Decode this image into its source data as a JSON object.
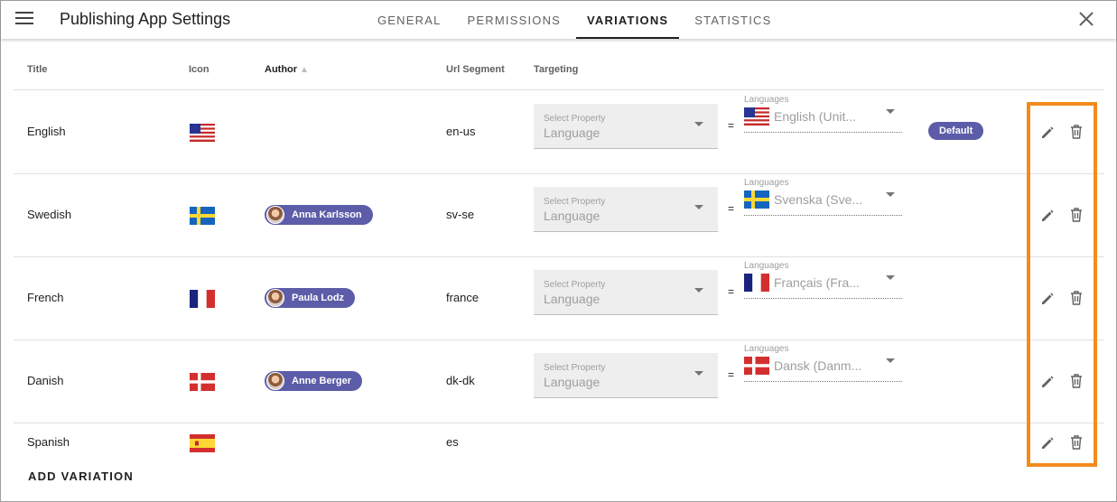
{
  "header": {
    "title": "Publishing App Settings",
    "tabs": [
      {
        "label": "GENERAL",
        "active": false
      },
      {
        "label": "PERMISSIONS",
        "active": false
      },
      {
        "label": "VARIATIONS",
        "active": true
      },
      {
        "label": "STATISTICS",
        "active": false
      }
    ]
  },
  "table": {
    "columns": {
      "title": "Title",
      "icon": "Icon",
      "author": "Author",
      "url_segment": "Url Segment",
      "targeting": "Targeting"
    },
    "rows": [
      {
        "title": "English",
        "flag": "us-flag",
        "author": null,
        "url_segment": "en-us",
        "select_label": "Select Property",
        "select_value": "Language",
        "equals": "=",
        "languages_label": "Languages",
        "language_value": "English (Unit...",
        "badge": "Default"
      },
      {
        "title": "Swedish",
        "flag": "se-flag",
        "author": "Anna Karlsson",
        "url_segment": "sv-se",
        "select_label": "Select Property",
        "select_value": "Language",
        "equals": "=",
        "languages_label": "Languages",
        "language_value": "Svenska (Sve..."
      },
      {
        "title": "French",
        "flag": "fr-flag",
        "author": "Paula Lodz",
        "url_segment": "france",
        "select_label": "Select Property",
        "select_value": "Language",
        "equals": "=",
        "languages_label": "Languages",
        "language_value": "Français (Fra..."
      },
      {
        "title": "Danish",
        "flag": "dk-flag",
        "author": "Anne Berger",
        "url_segment": "dk-dk",
        "select_label": "Select Property",
        "select_value": "Language",
        "equals": "=",
        "languages_label": "Languages",
        "language_value": "Dansk (Danm..."
      },
      {
        "title": "Spanish",
        "flag": "es-flag",
        "author": null,
        "url_segment": "es"
      }
    ]
  },
  "actions": {
    "add_variation": "ADD VARIATION"
  },
  "colors": {
    "chip": "#5c5ca8",
    "highlight": "#f28a1c"
  },
  "icons": [
    "menu-icon",
    "close-icon",
    "sort-arrow-icon",
    "edit-pencil-icon",
    "delete-trash-icon"
  ]
}
